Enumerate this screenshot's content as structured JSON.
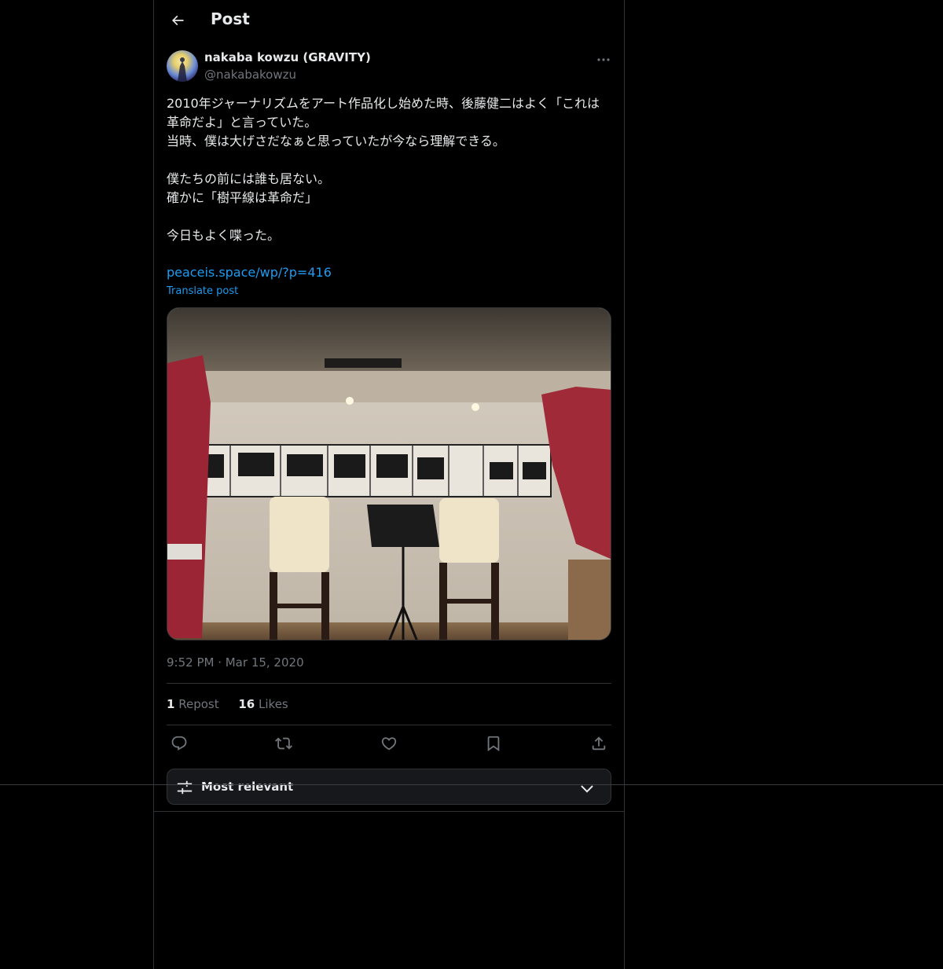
{
  "header": {
    "title": "Post",
    "back_icon": "arrow-left-icon"
  },
  "post": {
    "author_name": "nakaba kowzu (GRAVITY)",
    "author_handle": "@nakabakowzu",
    "text_lines": [
      "2010年ジャーナリズムをアート作品化し始めた時、後藤健二はよく「これは革命だよ」と言っていた。",
      "当時、僕は大げさだなぁと思っていたが今なら理解できる。",
      "",
      "僕たちの前には誰も居ない。",
      "確かに「樹平線は革命だ」",
      "",
      "今日もよく喋った。"
    ],
    "link": "peaceis.space/wp/?p=416",
    "translate_label": "Translate post",
    "timestamp": "9:52 PM · Mar 15, 2020",
    "repost_count": "1",
    "repost_label": "Repost",
    "likes_count": "16",
    "likes_label": "Likes"
  },
  "actions": {
    "reply_icon": "reply-icon",
    "repost_icon": "repost-icon",
    "like_icon": "heart-icon",
    "bookmark_icon": "bookmark-icon",
    "share_icon": "share-icon"
  },
  "replies_sort": {
    "label": "Most relevant"
  },
  "colors": {
    "background": "#000000",
    "text": "#e7e9ea",
    "muted": "#71767b",
    "link": "#1d9bf0",
    "border": "#2f3336"
  }
}
